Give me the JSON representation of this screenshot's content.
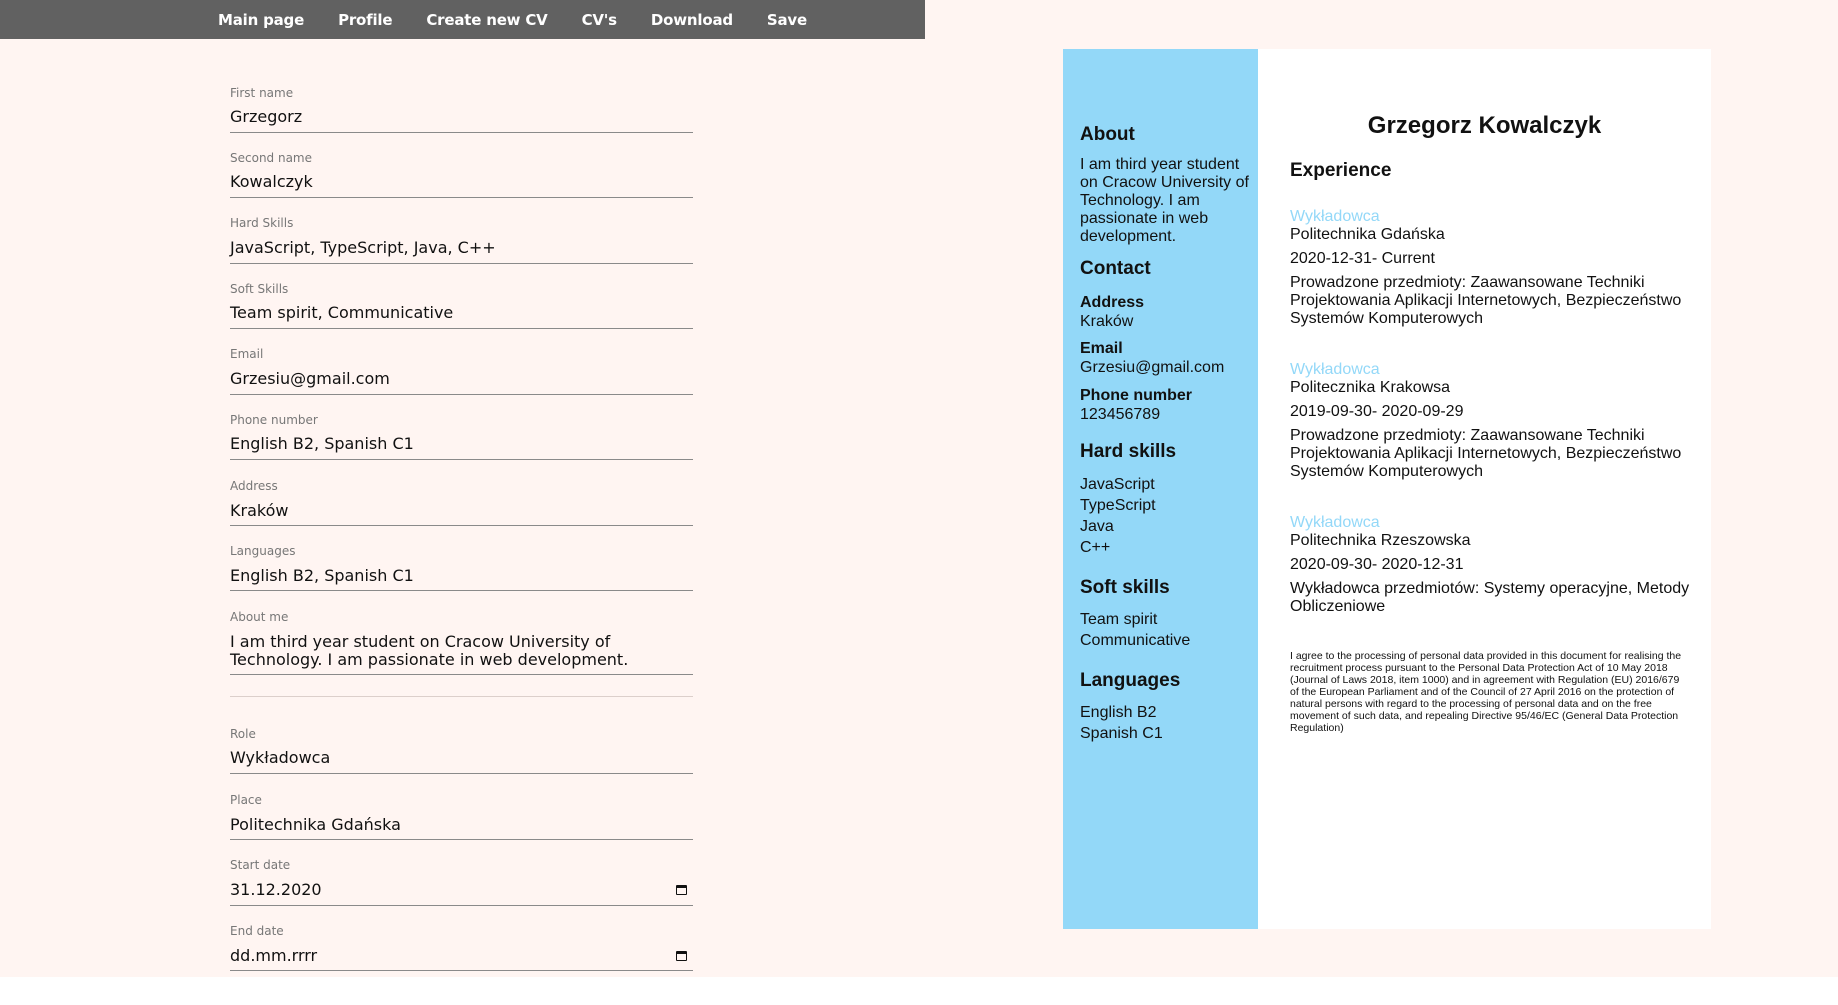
{
  "nav": {
    "items": [
      "Main page",
      "Profile",
      "Create new CV",
      "CV's",
      "Download",
      "Save"
    ]
  },
  "form": {
    "first_name": {
      "label": "First name",
      "value": "Grzegorz"
    },
    "second_name": {
      "label": "Second name",
      "value": "Kowalczyk"
    },
    "hard_skills": {
      "label": "Hard Skills",
      "value": "JavaScript, TypeScript, Java, C++"
    },
    "soft_skills": {
      "label": "Soft Skills",
      "value": "Team spirit, Communicative"
    },
    "email": {
      "label": "Email",
      "value": "Grzesiu@gmail.com"
    },
    "phone": {
      "label": "Phone number",
      "value": "English B2, Spanish C1"
    },
    "address": {
      "label": "Address",
      "value": "Kraków"
    },
    "languages": {
      "label": "Languages",
      "value": "English B2, Spanish C1"
    },
    "about": {
      "label": "About me",
      "value": "I am third year student on Cracow University of Technology. I am passionate in web development."
    },
    "role": {
      "label": "Role",
      "value": "Wykładowca"
    },
    "place": {
      "label": "Place",
      "value": "Politechnika Gdańska"
    },
    "start_date": {
      "label": "Start date",
      "value": "31.12.2020"
    },
    "end_date": {
      "label": "End date",
      "value": "dd.mm.rrrr"
    }
  },
  "cv": {
    "name": "Grzegorz Kowalczyk",
    "about_heading": "About",
    "about_text": "I am third year student on Cracow University of Technology. I am passionate in web development.",
    "contact_heading": "Contact",
    "address_label": "Address",
    "address": "Kraków",
    "email_label": "Email",
    "email": "Grzesiu@gmail.com",
    "phone_label": "Phone number",
    "phone": "123456789",
    "hard_skills_heading": "Hard skills",
    "hard_skills": [
      "JavaScript",
      "TypeScript",
      "Java",
      "C++"
    ],
    "soft_skills_heading": "Soft skills",
    "soft_skills": [
      "Team spirit",
      "Communicative"
    ],
    "languages_heading": "Languages",
    "languages": [
      "English B2",
      "Spanish C1"
    ],
    "experience_heading": "Experience",
    "jobs": [
      {
        "role": "Wykładowca",
        "place": "Politechnika Gdańska",
        "dates": "2020-12-31- Current",
        "desc": "Prowadzone przedmioty: Zaawansowane Techniki Projektowania Aplikacji Internetowych, Bezpieczeństwo Systemów Komputerowych"
      },
      {
        "role": "Wykładowca",
        "place": "Politecznika Krakowsa",
        "dates": "2019-09-30- 2020-09-29",
        "desc": "Prowadzone przedmioty: Zaawansowane Techniki Projektowania Aplikacji Internetowych, Bezpieczeństwo Systemów Komputerowych"
      },
      {
        "role": "Wykładowca",
        "place": "Politechnika Rzeszowska",
        "dates": "2020-09-30- 2020-12-31",
        "desc": "Wykładowca przedmiotów: Systemy operacyjne, Metody Obliczeniowe"
      }
    ],
    "consent": "I agree to the processing of personal data provided in this document for realising the recruitment process pursuant to the Personal Data Protection Act of 10 May 2018 (Journal of Laws 2018, item 1000) and in agreement with Regulation (EU) 2016/679 of the European Parliament and of the Council of 27 April 2016 on the protection of natural persons with regard to the processing of personal data and on the free movement of such data, and repealing Directive 95/46/EC (General Data Protection Regulation)"
  },
  "colors": {
    "navbar": "#616161",
    "page_background": "#fff5f2",
    "cv_sidebar": "#93d8f8",
    "role_accent": "#93d8f8"
  }
}
